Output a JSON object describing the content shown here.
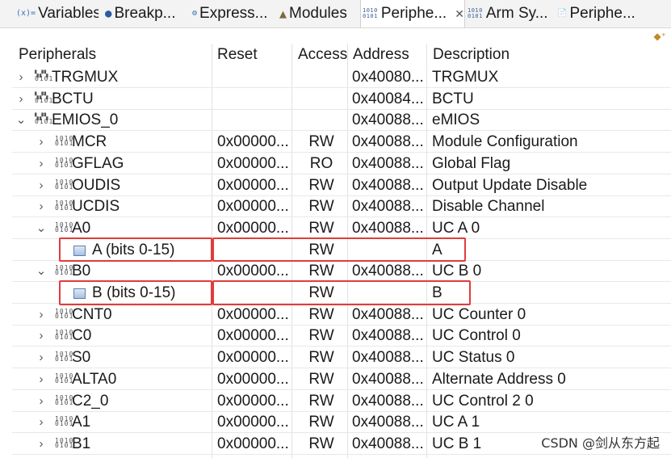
{
  "tabs": [
    {
      "prefix": "(x)=",
      "label": "Variables",
      "icon": "variables-icon",
      "active": false
    },
    {
      "prefix": "●",
      "label": "Breakp...",
      "icon": "breakpoints-icon",
      "active": false
    },
    {
      "prefix": "⚙",
      "label": "Express...",
      "icon": "expressions-icon",
      "active": false
    },
    {
      "prefix": "▲",
      "label": "Modules",
      "icon": "modules-icon",
      "active": false
    },
    {
      "prefix": "1010",
      "label": "Periphe...",
      "icon": "peripherals-icon",
      "active": true,
      "close": "✕"
    },
    {
      "prefix": "1010",
      "label": "Arm Sy...",
      "icon": "arm-system-registers-icon",
      "active": false
    },
    {
      "prefix": "📄",
      "label": "Periphe...",
      "icon": "peripherals-doc-icon",
      "active": false
    }
  ],
  "columns": {
    "name": "Peripherals",
    "reset": "Reset",
    "access": "Access",
    "address": "Address",
    "description": "Description"
  },
  "rows": [
    {
      "level": 0,
      "twisty": "›",
      "icon": "peripheral-group-icon",
      "name": "TRGMUX",
      "reset": "",
      "access": "",
      "address": "0x40080...",
      "description": "TRGMUX"
    },
    {
      "level": 0,
      "twisty": "›",
      "icon": "peripheral-group-icon",
      "name": "BCTU",
      "reset": "",
      "access": "",
      "address": "0x40084...",
      "description": "BCTU"
    },
    {
      "level": 0,
      "twisty": "⌄",
      "icon": "peripheral-group-icon",
      "name": "EMIOS_0",
      "reset": "",
      "access": "",
      "address": "0x40088...",
      "description": "eMIOS"
    },
    {
      "level": 1,
      "twisty": "›",
      "icon": "register-icon",
      "name": "MCR",
      "reset": "0x00000...",
      "access": "RW",
      "address": "0x40088...",
      "description": "Module Configuration"
    },
    {
      "level": 1,
      "twisty": "›",
      "icon": "register-icon",
      "name": "GFLAG",
      "reset": "0x00000...",
      "access": "RO",
      "address": "0x40088...",
      "description": "Global Flag"
    },
    {
      "level": 1,
      "twisty": "›",
      "icon": "register-icon",
      "name": "OUDIS",
      "reset": "0x00000...",
      "access": "RW",
      "address": "0x40088...",
      "description": "Output Update Disable"
    },
    {
      "level": 1,
      "twisty": "›",
      "icon": "register-icon",
      "name": "UCDIS",
      "reset": "0x00000...",
      "access": "RW",
      "address": "0x40088...",
      "description": "Disable Channel"
    },
    {
      "level": 1,
      "twisty": "⌄",
      "icon": "register-icon",
      "name": "A0",
      "reset": "0x00000...",
      "access": "RW",
      "address": "0x40088...",
      "description": "UC A 0"
    },
    {
      "level": 2,
      "twisty": "",
      "icon": "bitfield-icon",
      "name": "A (bits 0-15)",
      "reset": "",
      "access": "RW",
      "address": "",
      "description": "A",
      "highlight": true
    },
    {
      "level": 1,
      "twisty": "⌄",
      "icon": "register-icon",
      "name": "B0",
      "reset": "0x00000...",
      "access": "RW",
      "address": "0x40088...",
      "description": "UC B 0"
    },
    {
      "level": 2,
      "twisty": "",
      "icon": "bitfield-icon",
      "name": "B (bits 0-15)",
      "reset": "",
      "access": "RW",
      "address": "",
      "description": "B",
      "highlight": true
    },
    {
      "level": 1,
      "twisty": "›",
      "icon": "register-icon",
      "name": "CNT0",
      "reset": "0x00000...",
      "access": "RW",
      "address": "0x40088...",
      "description": "UC Counter 0"
    },
    {
      "level": 1,
      "twisty": "›",
      "icon": "register-icon",
      "name": "C0",
      "reset": "0x00000...",
      "access": "RW",
      "address": "0x40088...",
      "description": "UC Control 0"
    },
    {
      "level": 1,
      "twisty": "›",
      "icon": "register-icon",
      "name": "S0",
      "reset": "0x00000...",
      "access": "RW",
      "address": "0x40088...",
      "description": "UC Status 0"
    },
    {
      "level": 1,
      "twisty": "›",
      "icon": "register-icon",
      "name": "ALTA0",
      "reset": "0x00000...",
      "access": "RW",
      "address": "0x40088...",
      "description": "Alternate Address 0"
    },
    {
      "level": 1,
      "twisty": "›",
      "icon": "register-icon",
      "name": "C2_0",
      "reset": "0x00000...",
      "access": "RW",
      "address": "0x40088...",
      "description": "UC Control 2 0"
    },
    {
      "level": 1,
      "twisty": "›",
      "icon": "register-icon",
      "name": "A1",
      "reset": "0x00000...",
      "access": "RW",
      "address": "0x40088...",
      "description": "UC A 1"
    },
    {
      "level": 1,
      "twisty": "›",
      "icon": "register-icon",
      "name": "B1",
      "reset": "0x00000...",
      "access": "RW",
      "address": "0x40088...",
      "description": "UC B 1"
    }
  ],
  "watermark": "CSDN @剑从东方起",
  "colors": {
    "highlight": "#e23b3b",
    "tab_bg": "#f3f3f3",
    "grid": "#e2e2e2"
  }
}
